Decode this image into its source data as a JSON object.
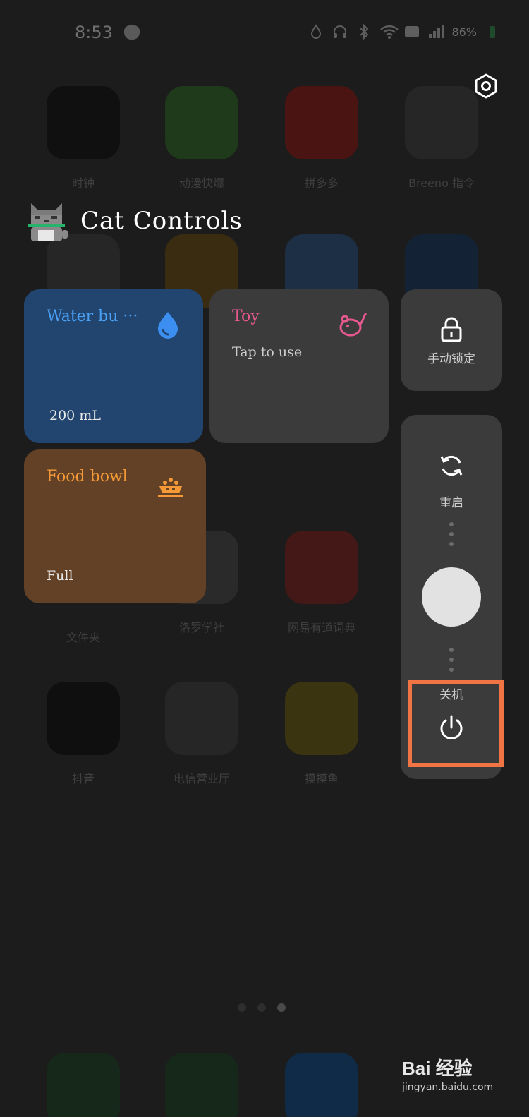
{
  "status_bar": {
    "time": "8:53",
    "battery": "86%"
  },
  "home_apps": [
    {
      "label": "时钟",
      "color": "#101010"
    },
    {
      "label": "动漫快爆",
      "color": "#1f3a1b"
    },
    {
      "label": "拼多多",
      "color": "#4a1412"
    },
    {
      "label": "Breeno 指令",
      "color": "#262626"
    },
    {
      "label": "",
      "color": "#262626"
    },
    {
      "label": "",
      "color": "#3a2c10"
    },
    {
      "label": "",
      "color": "#1c2f44"
    },
    {
      "label": "",
      "color": "#132235"
    },
    {
      "label": "文件夹",
      "color": "#262626"
    },
    {
      "label": "洛罗学社",
      "color": "#2a2a2a"
    },
    {
      "label": "网易有道词典",
      "color": "#431816"
    },
    {
      "label": "",
      "color": "#1c1c1c"
    },
    {
      "label": "抖音",
      "color": "#0f0f0f"
    },
    {
      "label": "电信营业厅",
      "color": "#262626"
    },
    {
      "label": "摸摸鱼",
      "color": "#3b3411"
    },
    {
      "label": "",
      "color": "#1c1c1c"
    }
  ],
  "header": {
    "title": "Cat Controls"
  },
  "tiles": {
    "water": {
      "name": "Water bu ···",
      "value": "200 mL"
    },
    "toy": {
      "name": "Toy",
      "value": "Tap to use"
    },
    "food": {
      "name": "Food bowl",
      "value": "Full"
    }
  },
  "power_menu": {
    "lock_label": "手动锁定",
    "restart_label": "重启",
    "shutdown_label": "关机"
  },
  "watermark": {
    "logo": "Bai  经验",
    "url": "jingyan.baidu.com"
  },
  "colors": {
    "water_tile": "#21456f",
    "food_tile": "#624126",
    "toy_tile": "#3b3b3b",
    "highlight": "#f07444"
  }
}
